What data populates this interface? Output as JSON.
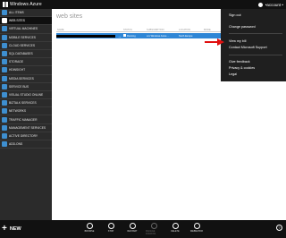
{
  "topbar": {
    "brand": "Windows Azure",
    "account": "•account •"
  },
  "sidebar": {
    "items": [
      {
        "label": "ALL ITEMS"
      },
      {
        "label": "WEB SITES"
      },
      {
        "label": "VIRTUAL MACHINES"
      },
      {
        "label": "MOBILE SERVICES"
      },
      {
        "label": "CLOUD SERVICES"
      },
      {
        "label": "SQL DATABASES"
      },
      {
        "label": "STORAGE"
      },
      {
        "label": "HDINSIGHT"
      },
      {
        "label": "MEDIA SERVICES"
      },
      {
        "label": "SERVICE BUS"
      },
      {
        "label": "VISUAL STUDIO ONLINE"
      },
      {
        "label": "BIZTALK SERVICES"
      },
      {
        "label": "NETWORKS"
      },
      {
        "label": "TRAFFIC MANAGER"
      },
      {
        "label": "MANAGEMENT SERVICES"
      },
      {
        "label": "ACTIVE DIRECTORY"
      },
      {
        "label": "ADD-ONS"
      }
    ]
  },
  "main": {
    "title": "web sites",
    "columns": [
      "NAME",
      "",
      "STATUS",
      "SUBSCRIPTION",
      "LOCATION",
      "MODE",
      "URL"
    ],
    "rows": [
      {
        "status": "Running",
        "subscription": "xxx  Windows Azure ...",
        "location": "North Europe",
        "mode": "",
        "url": ""
      }
    ]
  },
  "menu": {
    "items": [
      "Sign out",
      "Change password",
      "View my bill",
      "Contact Microsoft Support",
      "Give feedback",
      "Privacy & cookies",
      "Legal"
    ]
  },
  "bottombar": {
    "new_label": "NEW",
    "commands": [
      "BROWSE",
      "STOP",
      "RESTART",
      "MANAGE DOMAINS",
      "DELETE",
      "WEBMATRIX"
    ],
    "help": "?"
  }
}
